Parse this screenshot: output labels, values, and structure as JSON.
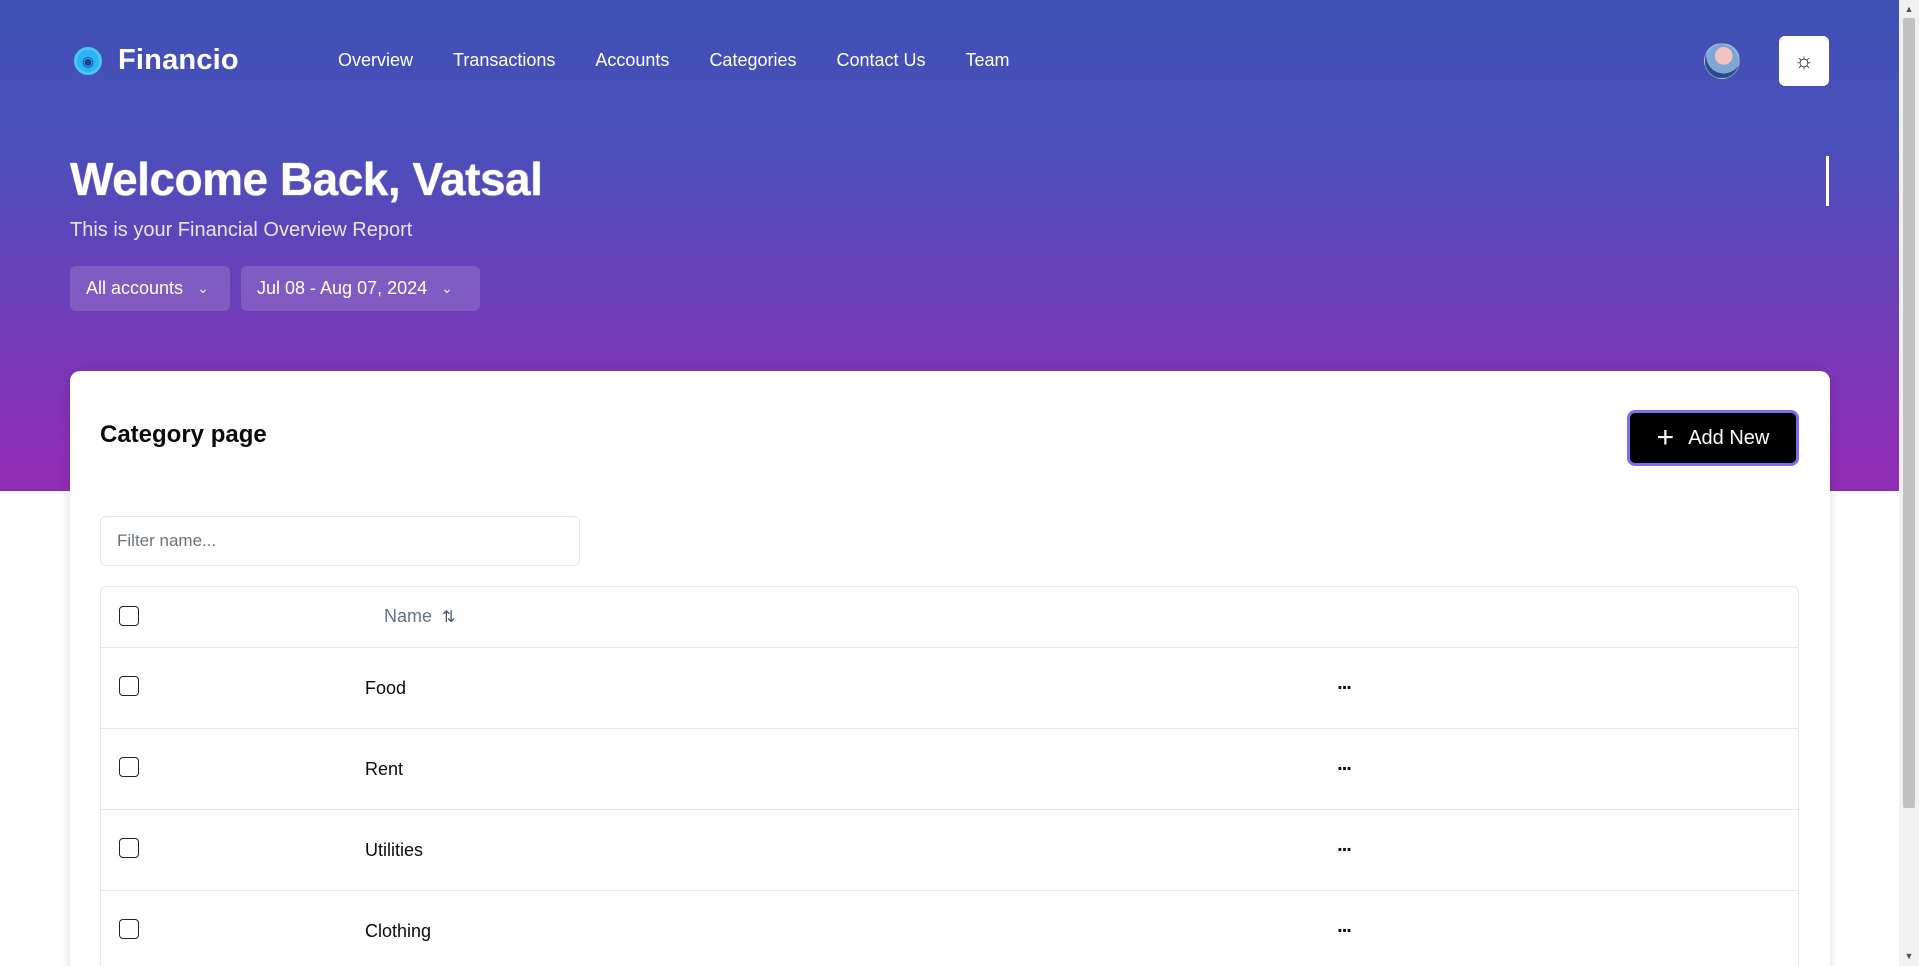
{
  "brand": {
    "name": "Financio",
    "icon": "globe-icon"
  },
  "nav": [
    "Overview",
    "Transactions",
    "Accounts",
    "Categories",
    "Contact Us",
    "Team"
  ],
  "header": {
    "theme_icon": "sun-icon",
    "avatar_icon": "user-avatar"
  },
  "hero": {
    "title": "Welcome Back, Vatsal",
    "subtitle": "This is your Financial Overview Report",
    "account_filter": "All accounts",
    "date_filter": "Jul 08 - Aug 07, 2024"
  },
  "card": {
    "title": "Category page",
    "add_label": "Add New",
    "filter_placeholder": "Filter name..."
  },
  "table": {
    "header_name": "Name",
    "rows": [
      "Food",
      "Rent",
      "Utilities",
      "Clothing"
    ],
    "row_action": "..."
  },
  "colors": {
    "hero_top": "#3f51b5",
    "hero_bottom": "#8f2db5",
    "accent_border": "#7c6cf0"
  }
}
